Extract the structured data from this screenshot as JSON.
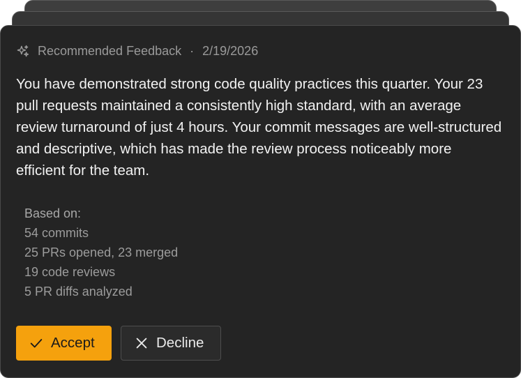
{
  "feedback": {
    "header": {
      "label": "Recommended Feedback",
      "separator": "·",
      "date": "2/19/2026"
    },
    "body": "You have demonstrated strong code quality practices this quarter. Your 23 pull requests maintained a consistently high standard, with an average review turnaround of just 4 hours. Your commit messages are well-structured and descriptive, which has made the review process noticeably more efficient for the team.",
    "based_on": {
      "title": "Based on:",
      "items": [
        "54 commits",
        "25 PRs opened, 23 merged",
        "19 code reviews",
        "5 PR diffs analyzed"
      ]
    },
    "actions": {
      "accept_label": "Accept",
      "decline_label": "Decline"
    }
  },
  "colors": {
    "accent": "#f5a10d",
    "card_bg": "#242424"
  },
  "icons": {
    "header": "sparkles-icon",
    "accept": "check-icon",
    "decline": "close-icon"
  }
}
